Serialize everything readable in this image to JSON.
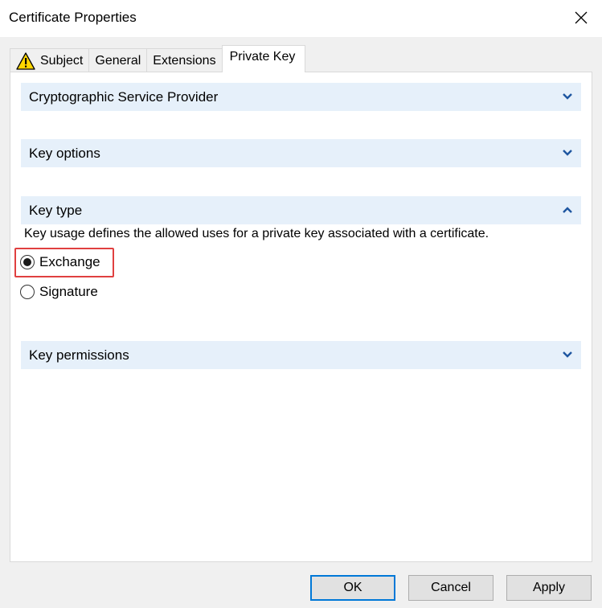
{
  "window": {
    "title": "Certificate Properties"
  },
  "tabs": [
    {
      "label": "Subject",
      "has_warning": true
    },
    {
      "label": "General"
    },
    {
      "label": "Extensions"
    },
    {
      "label": "Private Key",
      "active": true
    }
  ],
  "sections": {
    "csp": {
      "label": "Cryptographic Service Provider",
      "expanded": false
    },
    "key_options": {
      "label": "Key options",
      "expanded": false
    },
    "key_type": {
      "label": "Key type",
      "expanded": true
    },
    "key_permissions": {
      "label": "Key permissions",
      "expanded": false
    }
  },
  "key_type": {
    "description": "Key usage defines the allowed uses for a private key associated with a certificate.",
    "options": [
      {
        "label": "Exchange",
        "selected": true
      },
      {
        "label": "Signature",
        "selected": false
      }
    ]
  },
  "buttons": {
    "ok": "OK",
    "cancel": "Cancel",
    "apply": "Apply"
  },
  "colors": {
    "section_bg": "#e6f0fa",
    "chevron": "#1e56a0",
    "highlight": "#e04040",
    "default_button_border": "#0078d7"
  }
}
